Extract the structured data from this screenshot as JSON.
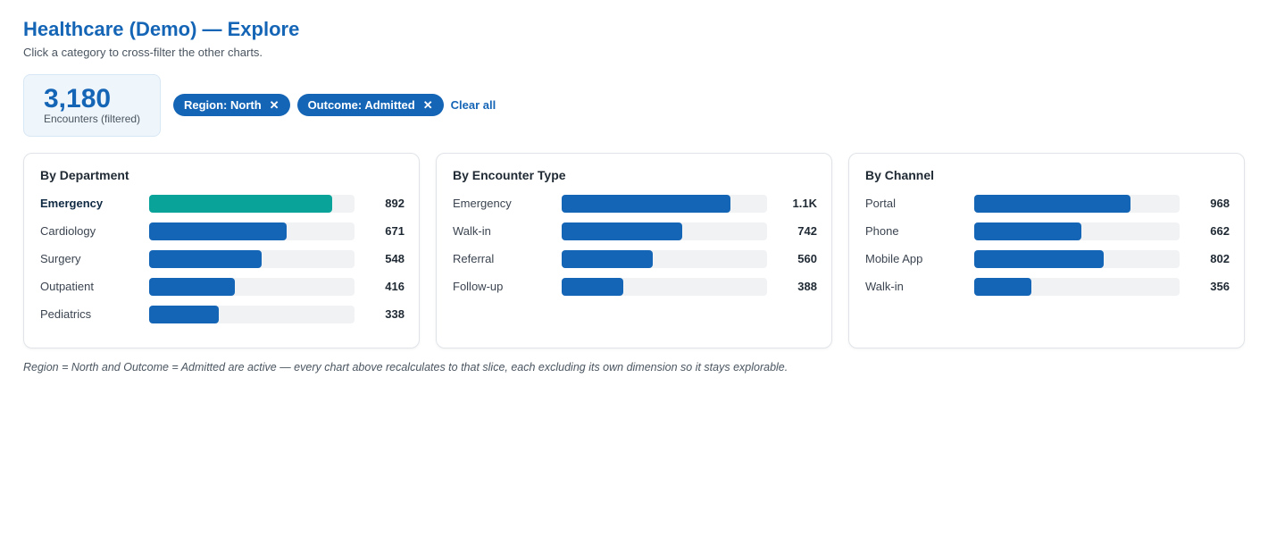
{
  "header": {
    "title": "Healthcare (Demo) — Explore",
    "subtitle": "Click a category to cross-filter the other charts."
  },
  "kpi": {
    "value": "3,180",
    "label": "Encounters (filtered)"
  },
  "filters": {
    "chips": [
      {
        "label": "Region: North",
        "remove": "✕"
      },
      {
        "label": "Outcome: Admitted",
        "remove": "✕"
      }
    ],
    "clear_label": "Clear all"
  },
  "colors": {
    "accent": "#1565b6",
    "active_bar": "#0aa39a",
    "track": "#f1f2f3"
  },
  "chart_data": [
    {
      "type": "bar",
      "title": "By Department",
      "bar_max": 1000,
      "categories": [
        "Emergency",
        "Cardiology",
        "Surgery",
        "Outpatient",
        "Pediatrics"
      ],
      "values": [
        892,
        671,
        548,
        416,
        338
      ],
      "labels": [
        "892",
        "671",
        "548",
        "416",
        "338"
      ],
      "active_index": 0
    },
    {
      "type": "bar",
      "title": "By Encounter Type",
      "bar_max": 1300,
      "categories": [
        "Emergency",
        "Walk-in",
        "Referral",
        "Follow-up"
      ],
      "values": [
        1068,
        762,
        575,
        392
      ],
      "labels": [
        "1.1K",
        "742",
        "560",
        "388"
      ],
      "active_index": -1
    },
    {
      "type": "bar",
      "title": "By Channel",
      "bar_max": 1270,
      "categories": [
        "Portal",
        "Phone",
        "Mobile App",
        "Walk-in"
      ],
      "values": [
        968,
        662,
        802,
        356
      ],
      "labels": [
        "968",
        "662",
        "802",
        "356"
      ],
      "active_index": -1
    }
  ],
  "footer": {
    "note": "Region = North and Outcome = Admitted are active — every chart above recalculates to that slice, each excluding its own dimension so it stays explorable."
  }
}
